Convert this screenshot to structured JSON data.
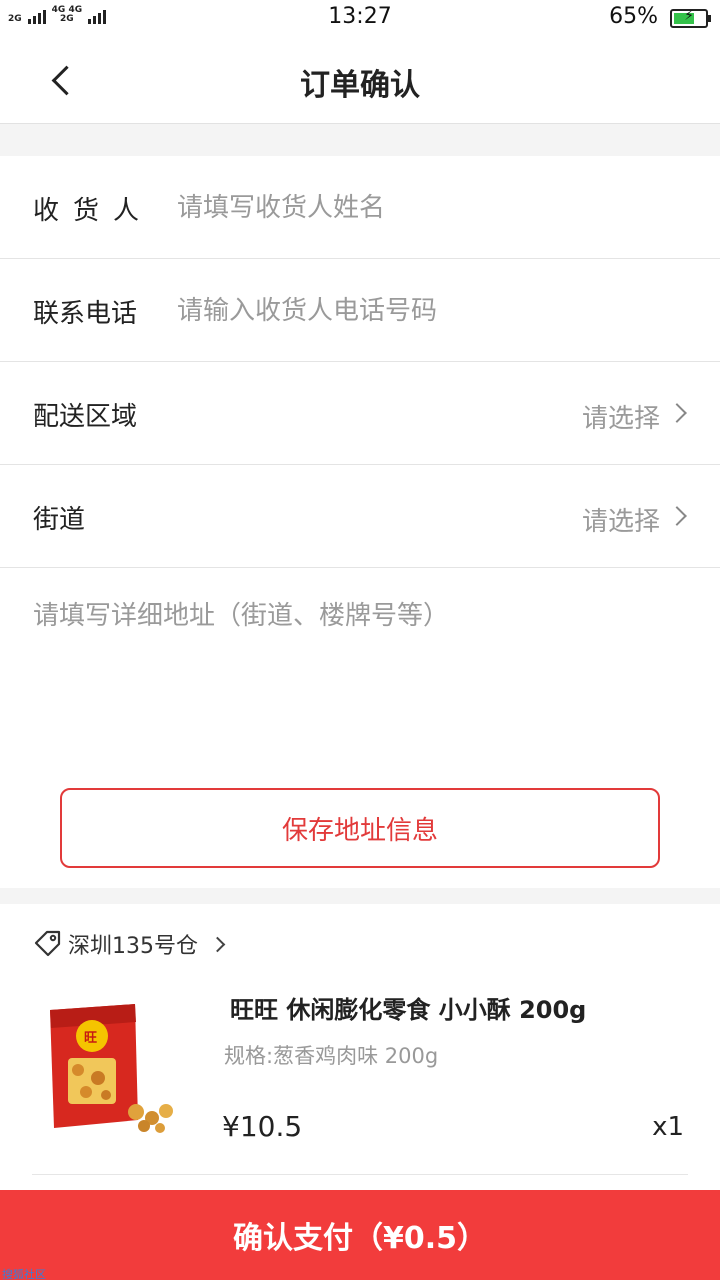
{
  "status_bar": {
    "net_left": "2G",
    "net_mid": "4G 4G",
    "net_sub": "2G",
    "time": "13:27",
    "battery_percent": "65%",
    "battery_level": 0.65,
    "battery_icon": "charging-bolt-icon",
    "battery_bolt": "⚡"
  },
  "header": {
    "title": "订单确认",
    "back_icon": "chevron-left-icon"
  },
  "form": {
    "receiver": {
      "label": "收货人",
      "placeholder": "请填写收货人姓名",
      "value": ""
    },
    "phone": {
      "label": "联系电话",
      "placeholder": "请输入收货人电话号码",
      "value": ""
    },
    "area": {
      "label": "配送区域",
      "value": "请选择"
    },
    "street": {
      "label": "街道",
      "value": "请选择"
    },
    "detail": {
      "placeholder": "请填写详细地址（街道、楼牌号等）",
      "value": ""
    },
    "save_label": "保存地址信息"
  },
  "order": {
    "store_name": "深圳135号仓",
    "store_icon": "tag-icon",
    "product": {
      "image_icon": "snack-package-image",
      "title": "旺旺 休闲膨化零食 小小酥 200g",
      "spec": "规格:葱香鸡肉味 200g",
      "price": "¥10.5",
      "quantity": "x1"
    }
  },
  "pay": {
    "label": "确认支付（¥0.5）"
  },
  "watermark": "搜狐社区",
  "colors": {
    "accent": "#f23c3c",
    "save_border": "#e23a3a",
    "battery_fill": "#34c24a",
    "placeholder": "#9a9a9a"
  }
}
